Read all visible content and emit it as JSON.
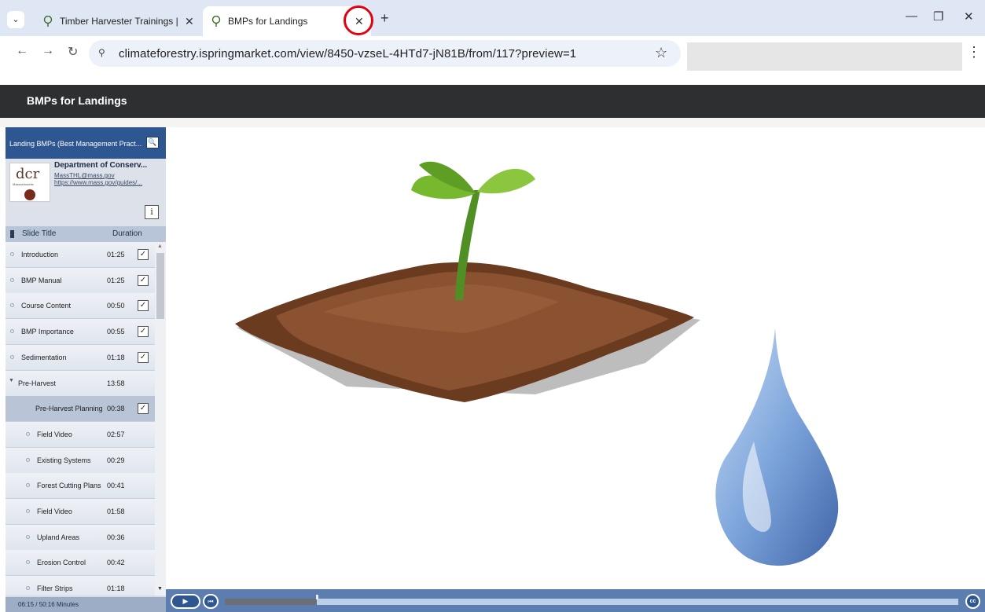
{
  "browser": {
    "tabs": [
      {
        "title": "Timber Harvester Trainings | Cli",
        "active": false
      },
      {
        "title": "BMPs for Landings",
        "active": true
      }
    ],
    "tab_close_glyph": "✕",
    "new_tab_glyph": "+",
    "window_controls": {
      "minimize": "—",
      "restore": "❐",
      "close": "✕"
    },
    "nav": {
      "back": "←",
      "forward": "→",
      "reload": "↻"
    },
    "url": "climateforestry.ispringmarket.com/view/8450-vzseL-4HTd7-jN81B/from/117?preview=1",
    "star_glyph": "☆",
    "menu_glyph": "⋮",
    "site_info_glyph": "⚲",
    "highlight_color": "#e3000f"
  },
  "player": {
    "title": "BMPs for Landings",
    "search_label": "Landing BMPs (Best Management Pract...",
    "search_icon": "🔍",
    "presenter": {
      "logo_text": "dcr",
      "logo_subtext": "Massachusetts",
      "name": "Department of Conserv...",
      "email": "MassTHL@mass.gov",
      "website": "https://www.mass.gov/guides/..."
    },
    "info_label": "i",
    "outline_headers": {
      "title": "Slide Title",
      "duration": "Duration"
    },
    "slides": [
      {
        "title": "Introduction",
        "duration": "01:25",
        "checked": true,
        "level": 0
      },
      {
        "title": "BMP Manual",
        "duration": "01:25",
        "checked": true,
        "level": 0
      },
      {
        "title": "Course Content",
        "duration": "00:50",
        "checked": true,
        "level": 0
      },
      {
        "title": "BMP Importance",
        "duration": "00:55",
        "checked": true,
        "level": 0
      },
      {
        "title": "Sedimentation",
        "duration": "01:18",
        "checked": true,
        "level": 0
      },
      {
        "title": "Pre-Harvest",
        "duration": "13:58",
        "checked": false,
        "level": 0,
        "group": true
      },
      {
        "title": "Pre-Harvest Planning",
        "duration": "00:38",
        "checked": true,
        "level": 1,
        "selected": true
      },
      {
        "title": "Field Video",
        "duration": "02:57",
        "checked": false,
        "level": 1
      },
      {
        "title": "Existing Systems",
        "duration": "00:29",
        "checked": false,
        "level": 1
      },
      {
        "title": "Forest Cutting Plans",
        "duration": "00:41",
        "checked": false,
        "level": 1
      },
      {
        "title": "Field Video",
        "duration": "01:58",
        "checked": false,
        "level": 1
      },
      {
        "title": "Upland Areas",
        "duration": "00:36",
        "checked": false,
        "level": 1
      },
      {
        "title": "Erosion Control",
        "duration": "00:42",
        "checked": false,
        "level": 1
      },
      {
        "title": "Filter Strips",
        "duration": "01:18",
        "checked": false,
        "level": 1
      }
    ],
    "check_glyph": "✓",
    "expand_glyph": "▼",
    "time_status": "06:15 / 50:16 Minutes",
    "playback_progress": 0.125,
    "controls": {
      "play": "▶",
      "restart": "⏮",
      "cc": "cc"
    }
  },
  "colors": {
    "player_header": "#2d2f31",
    "sidebar_blue": "#2e5690",
    "controls_bar": "#5b7db0"
  }
}
